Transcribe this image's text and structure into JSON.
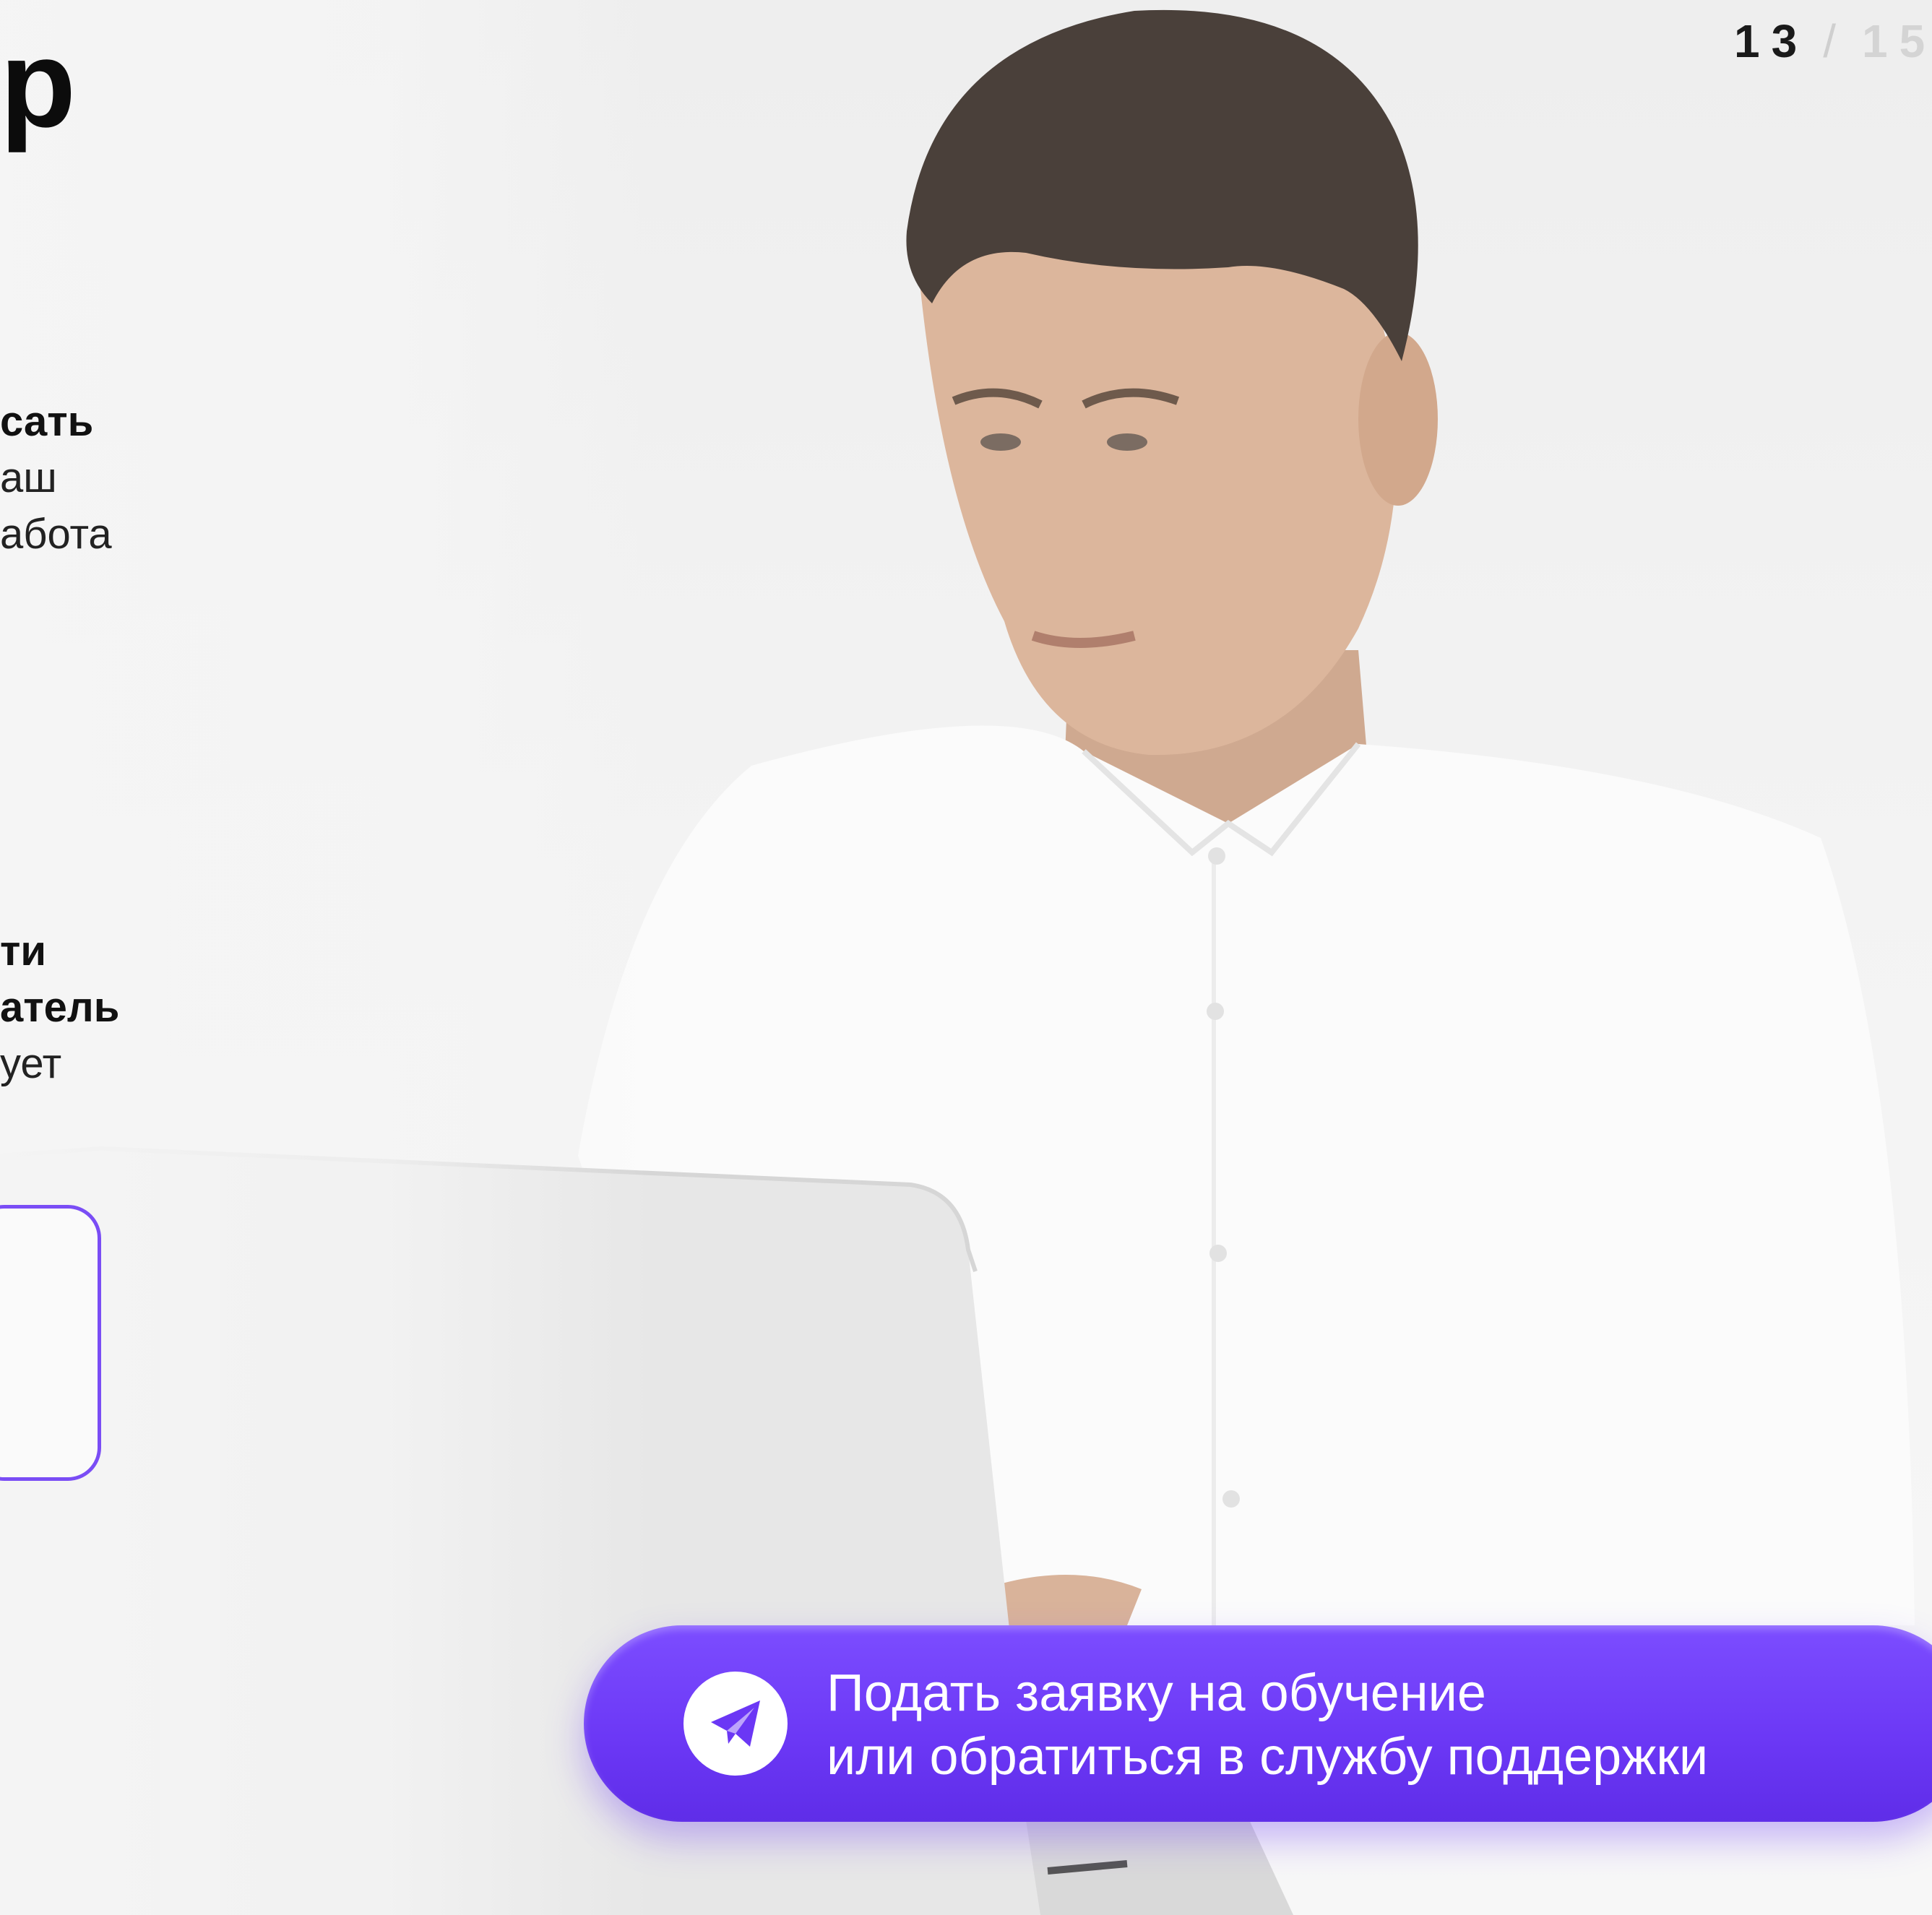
{
  "slide": {
    "title_fragment": "р",
    "counter": {
      "current": "13",
      "separator": "/",
      "total": "15"
    }
  },
  "text_blocks": [
    {
      "bold_lines": [
        "сать"
      ],
      "regular_lines": [
        "аш",
        "абота"
      ]
    },
    {
      "bold_lines": [
        "ти",
        "атель"
      ],
      "regular_lines": [
        "ует"
      ]
    }
  ],
  "cta": {
    "line1": "Подать заявку на обучение",
    "line2": "или обратиться в службу поддержки",
    "icon": "telegram-icon"
  },
  "colors": {
    "accent": "#6b37f5",
    "card_border": "#7a4df5",
    "background": "#f2f2f2"
  }
}
